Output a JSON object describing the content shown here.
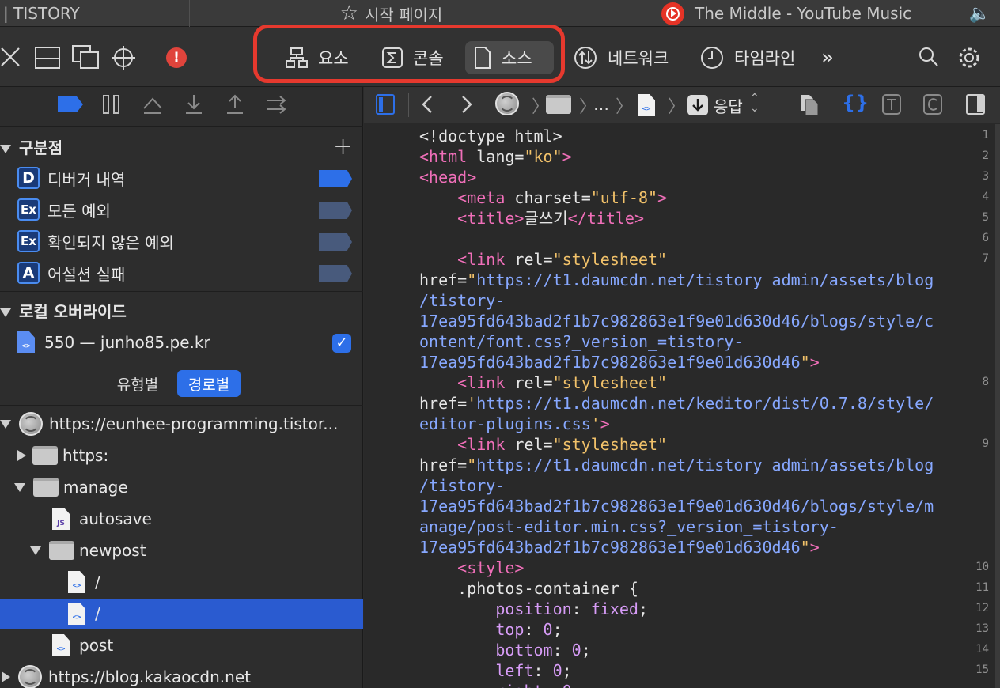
{
  "tabs": {
    "tab1": "| TISTORY",
    "tab2": "시작 페이지",
    "tab3": "The Middle - YouTube Music"
  },
  "toolbar": {
    "elements": "요소",
    "console": "콘솔",
    "sources": "소스",
    "network": "네트워크",
    "timeline": "타임라인",
    "more": "»",
    "warning": "!"
  },
  "breadcrumb": {
    "ellipsis": "…",
    "response": "응답"
  },
  "sidebar": {
    "breakpoints_header": "구분점",
    "breakpoints": [
      {
        "badge": "D",
        "label": "디버거 내역"
      },
      {
        "badge": "Ex",
        "label": "모든 예외"
      },
      {
        "badge": "Ex",
        "label": "확인되지 않은 예외"
      },
      {
        "badge": "A",
        "label": "어설션 실패"
      }
    ],
    "overrides_header": "로컬 오버라이드",
    "override_item": "550 — junho85.pe.kr",
    "segment": {
      "by_type": "유형별",
      "by_path": "경로별"
    },
    "tree": [
      {
        "label": "https://eunhee-programming.tistor..."
      },
      {
        "label": "https:"
      },
      {
        "label": "manage"
      },
      {
        "label": "autosave"
      },
      {
        "label": "newpost"
      },
      {
        "label": "/"
      },
      {
        "label": "/"
      },
      {
        "label": "post"
      },
      {
        "label": "https://blog.kakaocdn.net"
      }
    ]
  },
  "source": {
    "line_numbers": [
      "1",
      "2",
      "3",
      "4",
      "5",
      "6",
      "7",
      "8",
      "9",
      "10",
      "11",
      "12",
      "13",
      "14",
      "15"
    ]
  },
  "colors": {
    "accent": "#2d6fe8",
    "highlight_border": "#e6392e",
    "selected_row": "#2a5bd0"
  }
}
